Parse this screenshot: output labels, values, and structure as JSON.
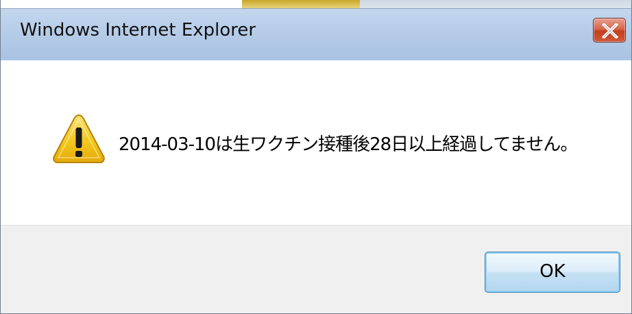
{
  "window": {
    "title": "Windows Internet Explorer",
    "close_icon": "close-x-icon"
  },
  "dialog": {
    "icon": "warning-triangle-icon",
    "message": "2014-03-10は生ワクチン接種後28日以上経過してません。",
    "ok_label": "OK"
  },
  "colors": {
    "titlebar": "#b7cde8",
    "close_button": "#d2583a",
    "footer": "#f0f0f0",
    "ok_button_border": "#3c7fb1",
    "warning_yellow": "#f2c51a"
  }
}
